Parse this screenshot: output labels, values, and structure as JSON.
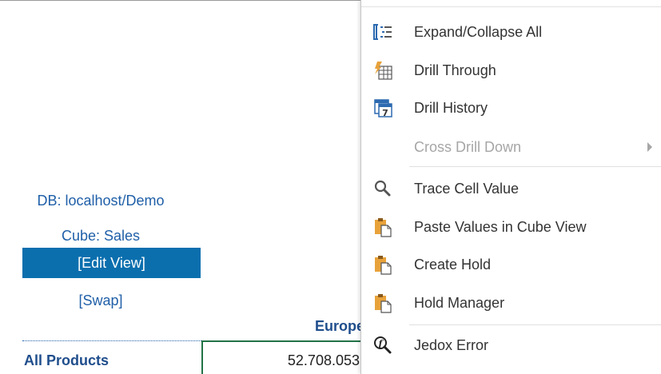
{
  "sheet": {
    "db_label": "DB: localhost/Demo",
    "cube_label": "Cube: Sales",
    "edit_view_label": "[Edit View]",
    "swap_label": "[Swap]",
    "column_header": "Europe",
    "row_header": "All Products",
    "cell_value": "52.708.053"
  },
  "context_menu": {
    "items": [
      {
        "label": "Expand/Collapse All",
        "icon": "expand-collapse-icon",
        "enabled": true
      },
      {
        "label": "Drill Through",
        "icon": "drill-through-icon",
        "enabled": true
      },
      {
        "label": "Drill History",
        "icon": "drill-history-icon",
        "enabled": true
      },
      {
        "label": "Cross Drill Down",
        "icon": "none",
        "enabled": false,
        "has_submenu": true
      },
      {
        "label": "Trace Cell Value",
        "icon": "search-icon",
        "enabled": true
      },
      {
        "label": "Paste Values in Cube View",
        "icon": "clipboard-paste-icon",
        "enabled": true
      },
      {
        "label": "Create Hold",
        "icon": "clipboard-paste-icon",
        "enabled": true
      },
      {
        "label": "Hold Manager",
        "icon": "clipboard-paste-icon",
        "enabled": true
      },
      {
        "label": "Jedox Error",
        "icon": "function-magnifier-icon",
        "enabled": true
      }
    ],
    "drill_history_icon_number": "7",
    "jedox_error_icon_letter": "f"
  },
  "colors": {
    "link_blue": "#1f5fa8",
    "selected_blue": "#0b6fae",
    "cell_border_green": "#217346",
    "icon_blue": "#2d6ab0",
    "icon_orange": "#e8a23a"
  }
}
